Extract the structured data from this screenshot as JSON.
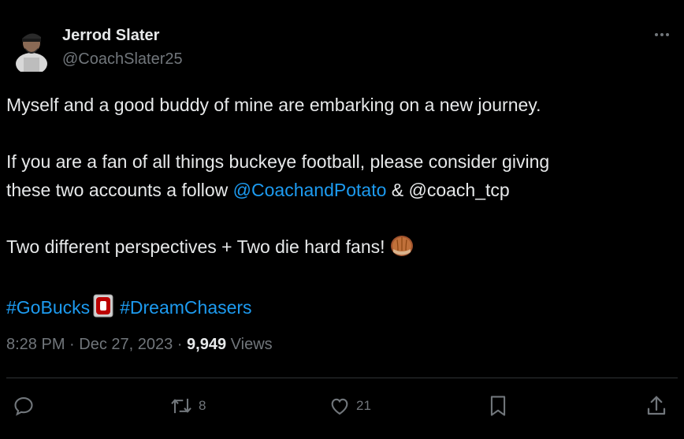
{
  "author": {
    "display_name": "Jerrod Slater",
    "handle": "@CoachSlater25"
  },
  "tweet": {
    "line1": "Myself and a good buddy of mine are embarking on a new journey.",
    "line2": "If you are a fan of all things buckeye football, please consider giving",
    "line3_prefix": "these two accounts a follow ",
    "mention1": "@CoachandPotato",
    "line3_mid": " & @coach_tcp",
    "line4": "Two different perspectives + Two die hard fans! ",
    "hashtag1": "#GoBucks",
    "hashtag2": "#DreamChasers",
    "emoji_icons": [
      "buckeye-nut-icon",
      "ohio-state-block-o-icon"
    ]
  },
  "meta": {
    "time": "8:28 PM",
    "separator1": " · ",
    "date": "Dec 27, 2023",
    "separator2": " · ",
    "views_count": "9,949",
    "views_label": " Views"
  },
  "actions": {
    "replies": "",
    "reposts": "8",
    "likes": "21",
    "icons": [
      "reply-icon",
      "repost-icon",
      "like-icon",
      "bookmark-icon",
      "share-icon"
    ]
  },
  "colors": {
    "background": "#000000",
    "text": "#e7e9ea",
    "secondary": "#71767b",
    "link": "#1d9bf0",
    "divider": "#2f3336"
  }
}
